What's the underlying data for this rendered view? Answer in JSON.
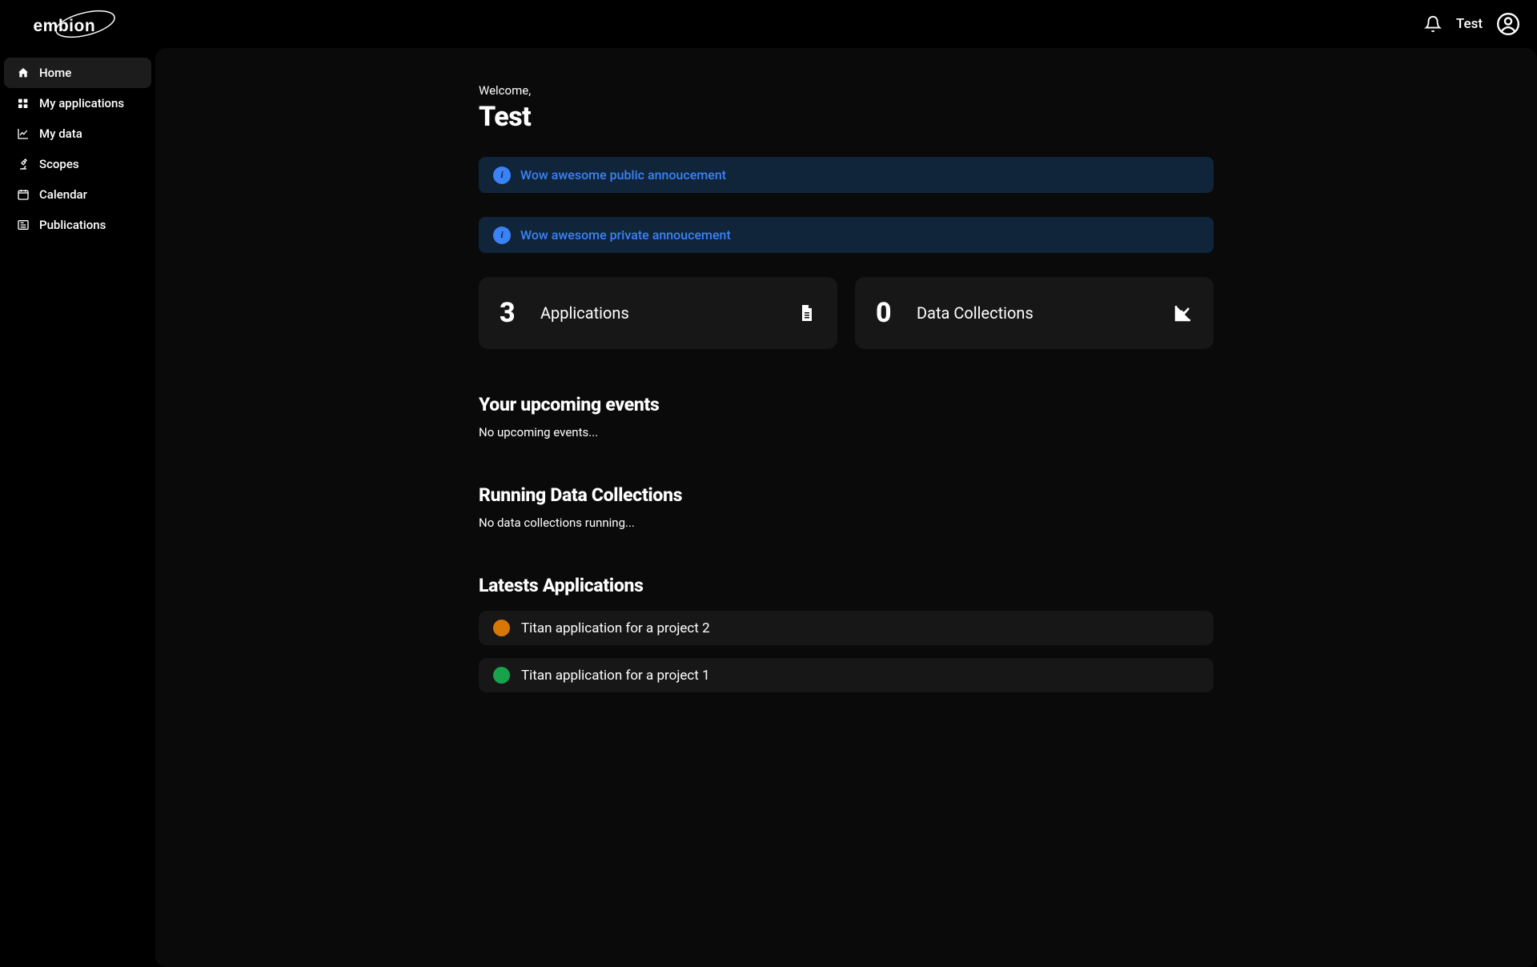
{
  "header": {
    "brand": "embion",
    "user_label": "Test"
  },
  "sidebar": {
    "items": [
      {
        "label": "Home",
        "icon": "home",
        "active": true
      },
      {
        "label": "My applications",
        "icon": "applications",
        "active": false
      },
      {
        "label": "My data",
        "icon": "chart",
        "active": false
      },
      {
        "label": "Scopes",
        "icon": "microscope",
        "active": false
      },
      {
        "label": "Calendar",
        "icon": "calendar",
        "active": false
      },
      {
        "label": "Publications",
        "icon": "news",
        "active": false
      }
    ]
  },
  "welcome": {
    "greeting": "Welcome,",
    "username": "Test"
  },
  "announcements": [
    {
      "text": "Wow awesome public annoucement"
    },
    {
      "text": "Wow awesome private annoucement"
    }
  ],
  "stats": {
    "applications": {
      "value": "3",
      "label": "Applications"
    },
    "data_collections": {
      "value": "0",
      "label": "Data Collections"
    }
  },
  "sections": {
    "upcoming": {
      "title": "Your upcoming events",
      "empty": "No upcoming events..."
    },
    "running": {
      "title": "Running Data Collections",
      "empty": "No data collections running..."
    },
    "latest": {
      "title": "Latests Applications"
    }
  },
  "latest_applications": [
    {
      "name": "Titan application for a project 2",
      "status_color": "orange"
    },
    {
      "name": "Titan application for a project 1",
      "status_color": "green"
    }
  ]
}
